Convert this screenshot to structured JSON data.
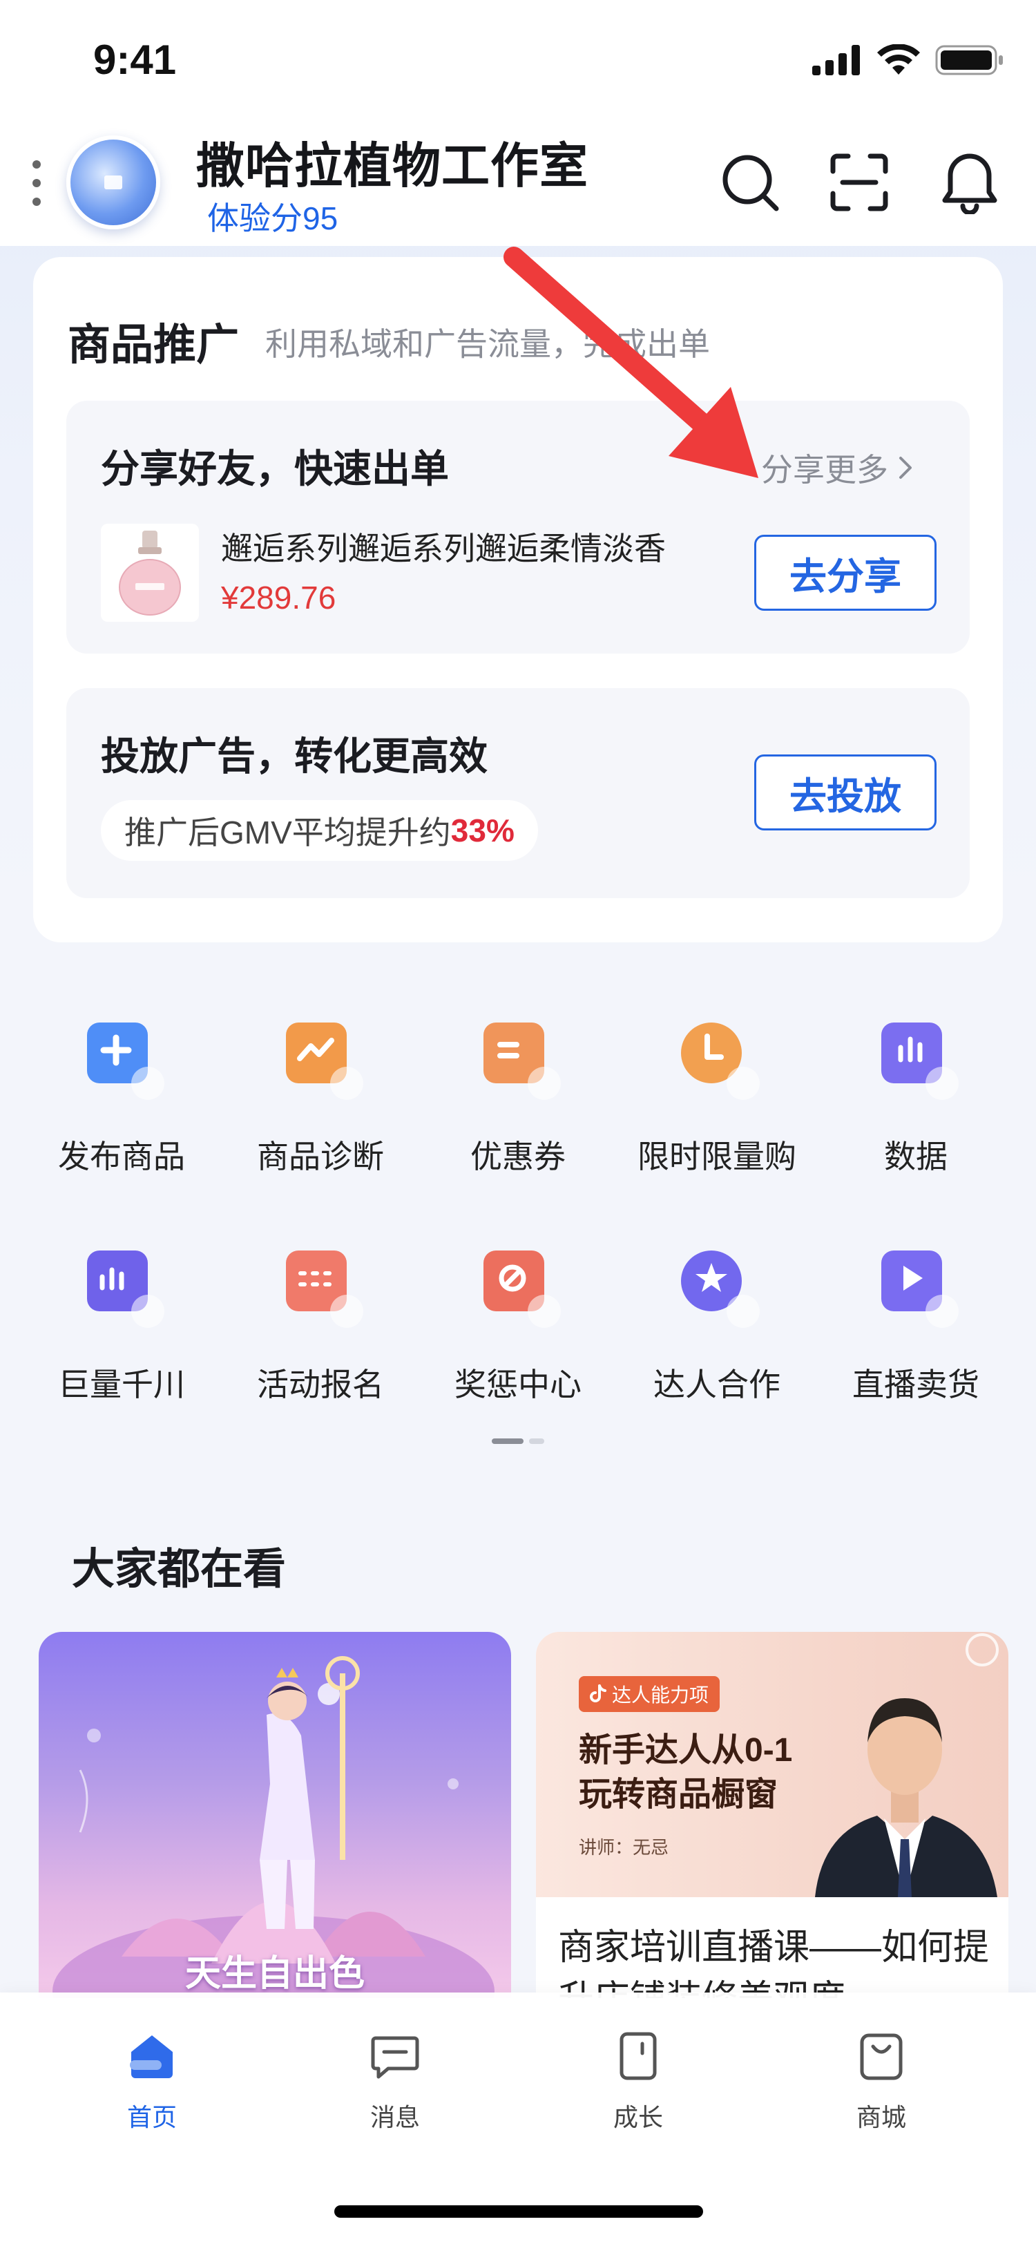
{
  "status_bar": {
    "time": "9:41"
  },
  "header": {
    "shop_name": "撒哈拉植物工作室",
    "score": "体验分95"
  },
  "promo": {
    "title": "商品推广",
    "subtitle": "利用私域和广告流量，完成出单",
    "share": {
      "title": "分享好友，快速出单",
      "more": "分享更多",
      "product_name": "邂逅系列邂逅系列邂逅柔情淡香",
      "product_price": "¥289.76",
      "button": "去分享"
    },
    "ad": {
      "title": "投放广告，转化更高效",
      "pill_text": "推广后GMV平均提升约",
      "pill_highlight": "33%",
      "button": "去投放"
    }
  },
  "tools": [
    {
      "label": "发布商品",
      "icon": "add-product-icon",
      "color": "#4f8ef7"
    },
    {
      "label": "商品诊断",
      "icon": "diagnosis-icon",
      "color": "#f29a4a"
    },
    {
      "label": "优惠券",
      "icon": "coupon-icon",
      "color": "#f0955a"
    },
    {
      "label": "限时限量购",
      "icon": "timer-icon",
      "color": "#f2a050"
    },
    {
      "label": "数据",
      "icon": "data-chart-icon",
      "color": "#7b6ef0"
    },
    {
      "label": "巨量千川",
      "icon": "qianchuan-icon",
      "color": "#6f62ea"
    },
    {
      "label": "活动报名",
      "icon": "activity-signup-icon",
      "color": "#f07a6a"
    },
    {
      "label": "奖惩中心",
      "icon": "reward-penalty-icon",
      "color": "#ec6f5e"
    },
    {
      "label": "达人合作",
      "icon": "influencer-star-icon",
      "color": "#7268ee"
    },
    {
      "label": "直播卖货",
      "icon": "live-play-icon",
      "color": "#7a6cf1"
    }
  ],
  "feed": {
    "title": "大家都在看",
    "card1_caption": "天生自出色",
    "card2": {
      "tag": "达人能力项",
      "headline_1": "新手达人从0-1",
      "headline_2": "玩转商品橱窗",
      "lecturer": "讲师：无忌",
      "desc": "商家培训直播课——如何提升店铺装修美观度"
    }
  },
  "tabbar": [
    {
      "label": "首页",
      "icon": "home-icon",
      "active": true
    },
    {
      "label": "消息",
      "icon": "message-icon",
      "active": false
    },
    {
      "label": "成长",
      "icon": "growth-icon",
      "active": false
    },
    {
      "label": "商城",
      "icon": "mall-bag-icon",
      "active": false
    }
  ],
  "accent_color": "#1f64e6",
  "highlight_red": "#e02a3a"
}
